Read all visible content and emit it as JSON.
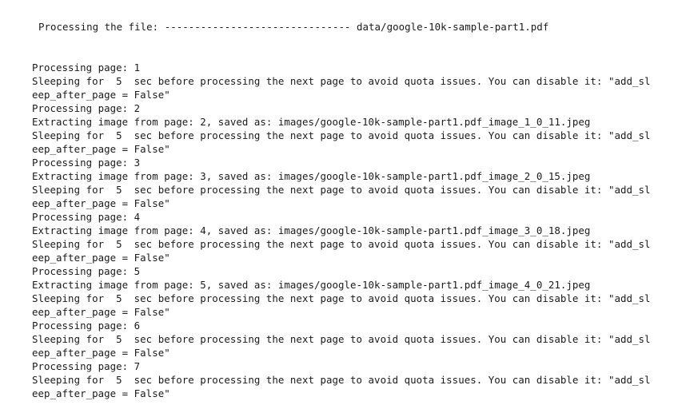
{
  "header": {
    "text": "Processing the file: ------------------------------- data/google-10k-sample-part1.pdf"
  },
  "log_lines": [
    "Processing page: 1",
    "Sleeping for  5  sec before processing the next page to avoid quota issues. You can disable it: \"add_sl",
    "eep_after_page = False\"",
    "Processing page: 2",
    "Extracting image from page: 2, saved as: images/google-10k-sample-part1.pdf_image_1_0_11.jpeg",
    "Sleeping for  5  sec before processing the next page to avoid quota issues. You can disable it: \"add_sl",
    "eep_after_page = False\"",
    "Processing page: 3",
    "Extracting image from page: 3, saved as: images/google-10k-sample-part1.pdf_image_2_0_15.jpeg",
    "Sleeping for  5  sec before processing the next page to avoid quota issues. You can disable it: \"add_sl",
    "eep_after_page = False\"",
    "Processing page: 4",
    "Extracting image from page: 4, saved as: images/google-10k-sample-part1.pdf_image_3_0_18.jpeg",
    "Sleeping for  5  sec before processing the next page to avoid quota issues. You can disable it: \"add_sl",
    "eep_after_page = False\"",
    "Processing page: 5",
    "Extracting image from page: 5, saved as: images/google-10k-sample-part1.pdf_image_4_0_21.jpeg",
    "Sleeping for  5  sec before processing the next page to avoid quota issues. You can disable it: \"add_sl",
    "eep_after_page = False\"",
    "Processing page: 6",
    "Sleeping for  5  sec before processing the next page to avoid quota issues. You can disable it: \"add_sl",
    "eep_after_page = False\"",
    "Processing page: 7",
    "Sleeping for  5  sec before processing the next page to avoid quota issues. You can disable it: \"add_sl",
    "eep_after_page = False\""
  ]
}
